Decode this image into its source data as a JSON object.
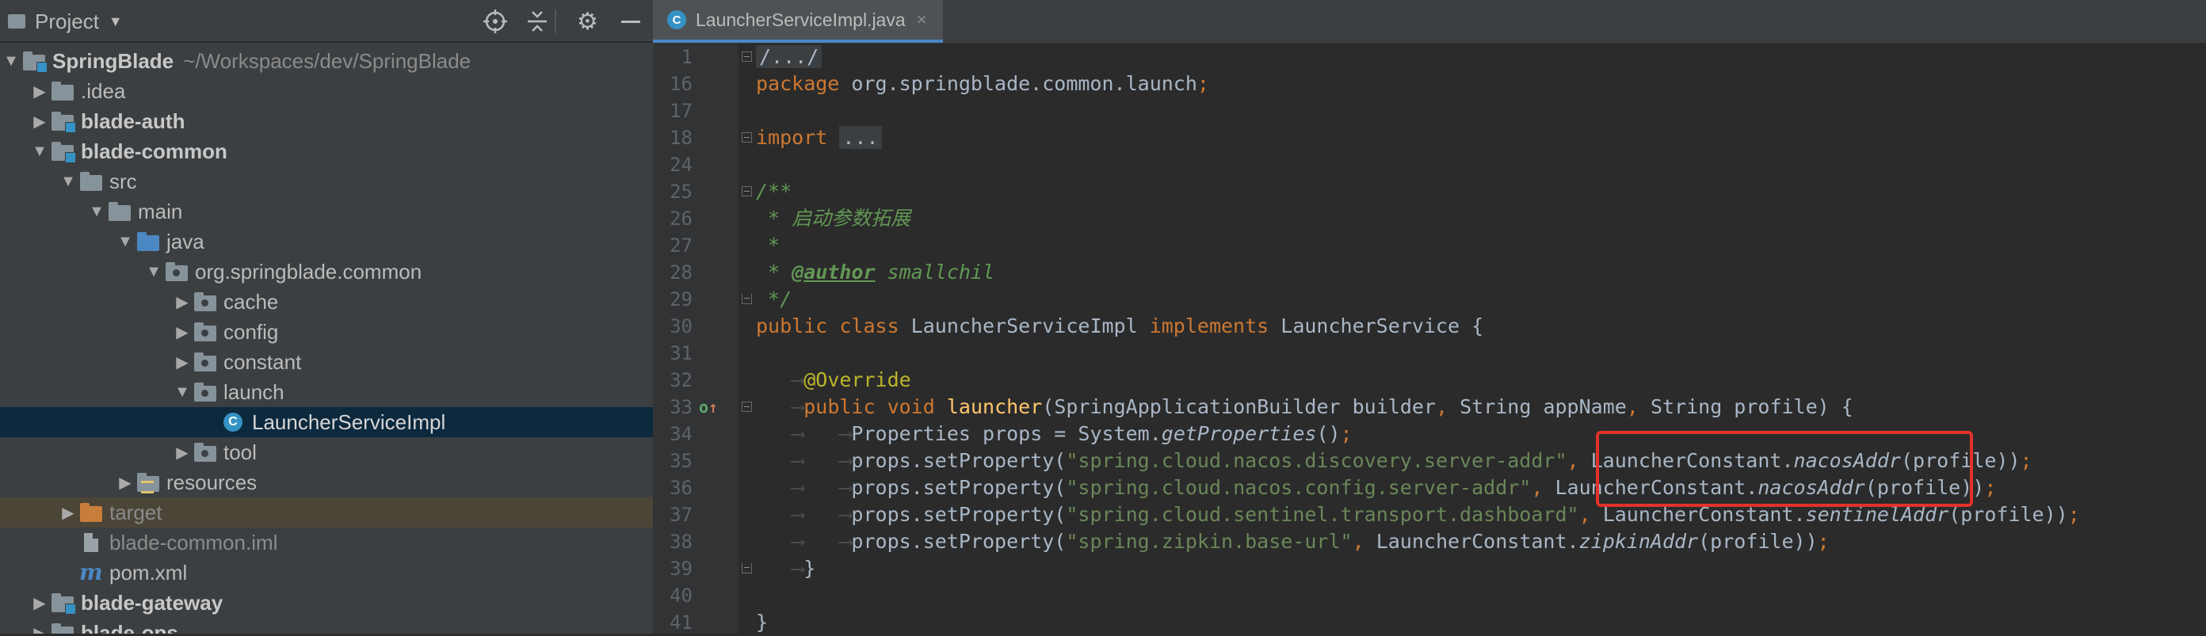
{
  "panel": {
    "title": "Project",
    "icons": [
      "target-icon",
      "collapse-icon",
      "gear-icon",
      "minimize-icon"
    ]
  },
  "tree": [
    {
      "indent": 0,
      "arrow": "down",
      "icon": "module-folder",
      "label": "SpringBlade",
      "bold": true,
      "path": "~/Workspaces/dev/SpringBlade"
    },
    {
      "indent": 1,
      "arrow": "right",
      "icon": "folder",
      "label": ".idea"
    },
    {
      "indent": 1,
      "arrow": "right",
      "icon": "module-folder",
      "label": "blade-auth",
      "bold": true
    },
    {
      "indent": 1,
      "arrow": "down",
      "icon": "module-folder",
      "label": "blade-common",
      "bold": true
    },
    {
      "indent": 2,
      "arrow": "down",
      "icon": "folder",
      "label": "src"
    },
    {
      "indent": 3,
      "arrow": "down",
      "icon": "folder",
      "label": "main"
    },
    {
      "indent": 4,
      "arrow": "down",
      "icon": "source-folder",
      "label": "java"
    },
    {
      "indent": 5,
      "arrow": "down",
      "icon": "package",
      "label": "org.springblade.common"
    },
    {
      "indent": 6,
      "arrow": "right",
      "icon": "package",
      "label": "cache"
    },
    {
      "indent": 6,
      "arrow": "right",
      "icon": "package",
      "label": "config"
    },
    {
      "indent": 6,
      "arrow": "right",
      "icon": "package",
      "label": "constant"
    },
    {
      "indent": 6,
      "arrow": "down",
      "icon": "package",
      "label": "launch"
    },
    {
      "indent": 7,
      "arrow": "none",
      "icon": "class",
      "label": "LauncherServiceImpl",
      "selected": true
    },
    {
      "indent": 6,
      "arrow": "right",
      "icon": "package",
      "label": "tool"
    },
    {
      "indent": 4,
      "arrow": "right",
      "icon": "resources",
      "label": "resources"
    },
    {
      "indent": 2,
      "arrow": "right",
      "icon": "excluded-folder",
      "label": "target",
      "excluded": true
    },
    {
      "indent": 2,
      "arrow": "none",
      "icon": "iml",
      "label": "blade-common.iml",
      "faded": true
    },
    {
      "indent": 2,
      "arrow": "none",
      "icon": "pom",
      "label": "pom.xml"
    },
    {
      "indent": 1,
      "arrow": "right",
      "icon": "module-folder",
      "label": "blade-gateway",
      "bold": true
    },
    {
      "indent": 1,
      "arrow": "right",
      "icon": "module-folder",
      "label": "blade-ops",
      "bold": true
    }
  ],
  "editor": {
    "tab_label": "LauncherServiceImpl.java",
    "tab_close": "×",
    "class_letter": "C",
    "lines": [
      {
        "n": "1",
        "fold": "start",
        "html": "<span class=\"folded\">/.../</span>"
      },
      {
        "n": "16",
        "html": "<span class=\"kw\">package</span> org.springblade.common.launch<span class=\"kw\">;</span>"
      },
      {
        "n": "17",
        "html": ""
      },
      {
        "n": "18",
        "fold": "start",
        "html": "<span class=\"kw\">import</span> <span class=\"folded\">...</span>"
      },
      {
        "n": "24",
        "html": ""
      },
      {
        "n": "25",
        "fold": "start",
        "html": "<span class=\"cmt\">/**</span>"
      },
      {
        "n": "26",
        "html": "<span class=\"cmt\"> * 启动参数拓展</span>"
      },
      {
        "n": "27",
        "html": "<span class=\"cmt\"> *</span>"
      },
      {
        "n": "28",
        "html": "<span class=\"cmt\"> * </span><span class=\"tag\">@author</span><span class=\"cmt\"> smallchil</span>"
      },
      {
        "n": "29",
        "fold": "end",
        "html": "<span class=\"cmt\"> */</span>"
      },
      {
        "n": "30",
        "html": "<span class=\"kw\">public class</span> LauncherServiceImpl <span class=\"kw\">implements</span> LauncherService {"
      },
      {
        "n": "31",
        "html": ""
      },
      {
        "n": "32",
        "html": "<span class=\"ws\">   ⟶</span><span class=\"ann\">@Override</span>"
      },
      {
        "n": "33",
        "fold": "start",
        "gutter": "override",
        "html": "<span class=\"ws\">   ⟶</span><span class=\"kw\">public void</span> <span class=\"fn\">launcher</span>(SpringApplicationBuilder builder<span class=\"kw\">,</span> String appName<span class=\"kw\">,</span> String profile) {"
      },
      {
        "n": "34",
        "html": "<span class=\"ws\">   ⟶   ⟶</span>Properties props = System.<span class=\"stat\">getProperties</span>()<span class=\"kw\">;</span>"
      },
      {
        "n": "35",
        "html": "<span class=\"ws\">   ⟶   ⟶</span>props.setProperty(<span class=\"str\">\"spring.cloud.nacos.discovery.server-addr\"</span><span class=\"kw\">,</span> LauncherConstant.<span class=\"stat\">nacosAddr</span>(profile))<span class=\"kw\">;</span>"
      },
      {
        "n": "36",
        "html": "<span class=\"ws\">   ⟶   ⟶</span>props.setProperty(<span class=\"str\">\"spring.cloud.nacos.config.server-addr\"</span><span class=\"kw\">,</span> LauncherConstant.<span class=\"stat\">nacosAddr</span>(profile))<span class=\"kw\">;</span>"
      },
      {
        "n": "37",
        "html": "<span class=\"ws\">   ⟶   ⟶</span>props.setProperty(<span class=\"str\">\"spring.cloud.sentinel.transport.dashboard\"</span><span class=\"kw\">,</span> LauncherConstant.<span class=\"stat\">sentinelAddr</span>(profile))<span class=\"kw\">;</span>"
      },
      {
        "n": "38",
        "html": "<span class=\"ws\">   ⟶   ⟶</span>props.setProperty(<span class=\"str\">\"spring.zipkin.base-url\"</span><span class=\"kw\">,</span> LauncherConstant.<span class=\"stat\">zipkinAddr</span>(profile))<span class=\"kw\">;</span>"
      },
      {
        "n": "39",
        "fold": "end",
        "html": "<span class=\"ws\">   ⟶</span>}"
      },
      {
        "n": "40",
        "html": ""
      },
      {
        "n": "41",
        "html": "}"
      }
    ]
  },
  "colors": {
    "highlight_box": "#e2322a",
    "selection": "#0d293e",
    "tab_underline": "#4a88c7"
  }
}
